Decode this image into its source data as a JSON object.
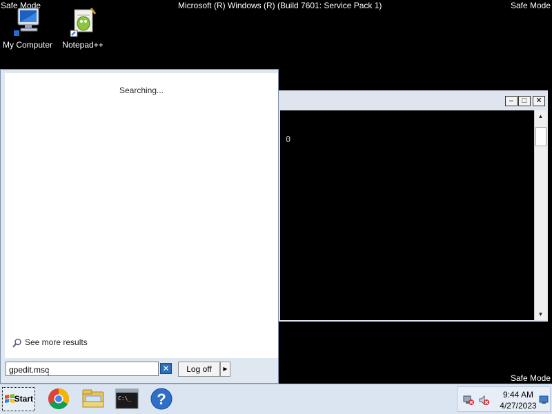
{
  "desktop": {
    "top_left_label": "Safe Mode",
    "top_right_label": "Safe Mode",
    "bottom_right_label": "Safe Mode",
    "build_info": "Microsoft (R) Windows (R) (Build 7601: Service Pack 1)",
    "icons": [
      {
        "label": "My Computer",
        "icon": "computer-icon"
      },
      {
        "label": "Notepad++",
        "icon": "notepadpp-icon"
      }
    ]
  },
  "console": {
    "output_text": "0",
    "buttons": {
      "minimize": "minimize-icon",
      "maximize": "maximize-icon",
      "close": "close-icon"
    }
  },
  "start_menu": {
    "status_text": "Searching...",
    "see_more_label": "See more results",
    "search_value": "gpedit.msc",
    "clear_icon": "clear-search-icon",
    "logoff_label": "Log off"
  },
  "taskbar": {
    "start_label": "Start",
    "pinned": [
      "chrome-icon",
      "explorer-icon",
      "cmd-icon",
      "help-icon"
    ],
    "clock_time": "9:44 AM",
    "clock_date": "4/27/2023"
  },
  "colors": {
    "desktop_bg": "#000000",
    "startmenu_frame": "#dfe7f1",
    "taskbar_bg": "#dbe5f1",
    "accent_blue": "#2d6fb8"
  }
}
